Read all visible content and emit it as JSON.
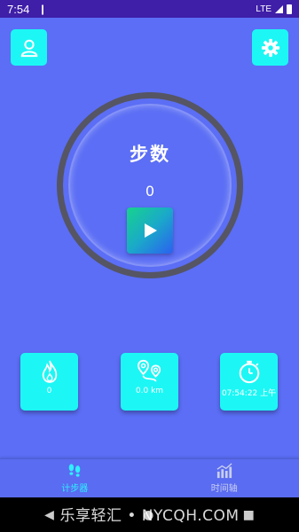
{
  "statusbar": {
    "time": "7:54",
    "network": "LTE"
  },
  "header": {
    "user_icon": "person-icon",
    "settings_icon": "gear-icon"
  },
  "counter": {
    "title": "步数",
    "steps": "0",
    "play_icon": "play-icon"
  },
  "stats": {
    "calories": {
      "icon": "flame-icon",
      "value": "0"
    },
    "distance": {
      "icon": "route-pins-icon",
      "value": "0.0 km"
    },
    "time": {
      "icon": "stopwatch-icon",
      "value": "07:54:22 上午"
    }
  },
  "nav": {
    "tabs": [
      {
        "label": "计步器",
        "icon": "footprints-icon",
        "active": true
      },
      {
        "label": "时间轴",
        "icon": "bar-chart-icon",
        "active": false
      }
    ]
  },
  "watermark": "乐享轻汇 • NYCQH.COM",
  "colors": {
    "background": "#5b6ef5",
    "accent": "#1cf7f5",
    "statusbar": "#3f1ea8",
    "active_tab": "#2ef0ff"
  }
}
